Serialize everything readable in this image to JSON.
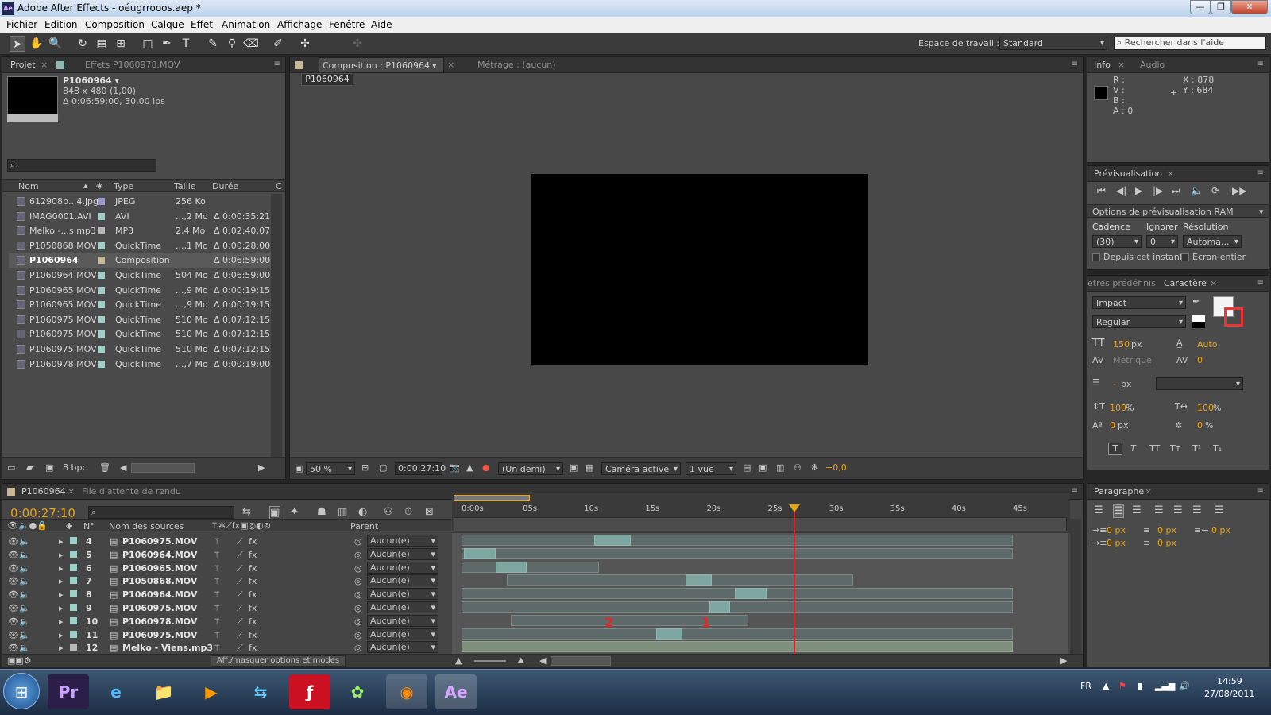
{
  "window": {
    "title": "Adobe After Effects - oéugrrooos.aep *",
    "app_icon": "Ae"
  },
  "menu": [
    "Fichier",
    "Edition",
    "Composition",
    "Calque",
    "Effet",
    "Animation",
    "Affichage",
    "Fenêtre",
    "Aide"
  ],
  "toolbar": {
    "workspace_label": "Espace de travail :",
    "workspace_value": "Standard",
    "search_placeholder": "Rechercher dans l'aide"
  },
  "project": {
    "tabs": [
      "Projet",
      "Effets P1060978.MOV"
    ],
    "item_name": "P1060964 ▾",
    "item_dims": "848 x 480 (1,00)",
    "item_duration": "Δ 0:06:59:00, 30,00 ips",
    "columns": [
      "Nom",
      "Type",
      "Taille",
      "Durée",
      "C"
    ],
    "rows": [
      {
        "name": "612908b...4.jpg",
        "type": "JPEG",
        "size": "256 Ko",
        "dur": "",
        "lc": "#9a9ad0"
      },
      {
        "name": "IMAG0001.AVI",
        "type": "AVI",
        "size": "...,2 Mo",
        "dur": "Δ 0:00:35:21",
        "lc": "#9fd0c8"
      },
      {
        "name": "Melko -...s.mp3",
        "type": "MP3",
        "size": "2,4 Mo",
        "dur": "Δ 0:02:40:07",
        "lc": "#b8b8b8"
      },
      {
        "name": "P1050868.MOV",
        "type": "QuickTime",
        "size": "...,1 Mo",
        "dur": "Δ 0:00:28:00",
        "lc": "#9fd0c8"
      },
      {
        "name": "P1060964",
        "type": "Composition",
        "size": "",
        "dur": "Δ 0:06:59:00",
        "lc": "#c8b896"
      },
      {
        "name": "P1060964.MOV",
        "type": "QuickTime",
        "size": "504 Mo",
        "dur": "Δ 0:06:59:00",
        "lc": "#9fd0c8"
      },
      {
        "name": "P1060965.MOV",
        "type": "QuickTime",
        "size": "...,9 Mo",
        "dur": "Δ 0:00:19:15",
        "lc": "#9fd0c8"
      },
      {
        "name": "P1060965.MOV",
        "type": "QuickTime",
        "size": "...,9 Mo",
        "dur": "Δ 0:00:19:15",
        "lc": "#9fd0c8"
      },
      {
        "name": "P1060975.MOV",
        "type": "QuickTime",
        "size": "510 Mo",
        "dur": "Δ 0:07:12:15",
        "lc": "#9fd0c8"
      },
      {
        "name": "P1060975.MOV",
        "type": "QuickTime",
        "size": "510 Mo",
        "dur": "Δ 0:07:12:15",
        "lc": "#9fd0c8"
      },
      {
        "name": "P1060975.MOV",
        "type": "QuickTime",
        "size": "510 Mo",
        "dur": "Δ 0:07:12:15",
        "lc": "#9fd0c8"
      },
      {
        "name": "P1060978.MOV",
        "type": "QuickTime",
        "size": "...,7 Mo",
        "dur": "Δ 0:00:19:00",
        "lc": "#9fd0c8"
      }
    ],
    "bpc": "8 bpc"
  },
  "comp": {
    "tabs": [
      "Composition : P1060964",
      "Métrage : (aucun)"
    ],
    "crumb": "P1060964",
    "zoom": "50 %",
    "time": "0:00:27:10",
    "resolution": "(Un demi)",
    "camera": "Caméra active",
    "views": "1 vue",
    "exposure": "+0,0"
  },
  "info": {
    "tabs": [
      "Info",
      "Audio"
    ],
    "r": "R :",
    "v": "V :",
    "b": "B :",
    "a": "A : 0",
    "x": "X : 878",
    "y": "Y : 684"
  },
  "preview": {
    "tab": "Prévisualisation",
    "ram": "Options de prévisualisation RAM",
    "cadence_label": "Cadence",
    "ignorer_label": "Ignorer",
    "resolution_label": "Résolution",
    "cadence": "(30)",
    "ignorer": "0",
    "resolution": "Automa...",
    "from_now": "Depuis cet instant",
    "fullscreen": "Ecran entier"
  },
  "character": {
    "tabs": [
      "etres prédéfinis",
      "Caractère"
    ],
    "font": "Impact",
    "style": "Regular",
    "size": "150",
    "size_unit": "px",
    "leading": "Auto",
    "kerning": "Métrique",
    "tracking": "0",
    "stroke": "-",
    "stroke_unit": "px",
    "vscale": "100",
    "hscale": "100",
    "pct": "%",
    "baseline": "0",
    "baseline_unit": "px",
    "tsume": "0",
    "tsume_unit": "%"
  },
  "paragraph": {
    "tab": "Paragraphe",
    "indents": [
      "0 px",
      "0 px",
      "0 px",
      "0 px",
      "0 px"
    ]
  },
  "timeline": {
    "tabs": [
      "P1060964",
      "File d'attente de rendu"
    ],
    "time": "0:00:27:10",
    "cols": {
      "num": "N°",
      "src": "Nom des sources",
      "parent": "Parent"
    },
    "ruler": [
      "0:00s",
      "05s",
      "10s",
      "15s",
      "20s",
      "25s",
      "30s",
      "35s",
      "40s",
      "45s"
    ],
    "layers": [
      {
        "n": "4",
        "name": "P1060975.MOV",
        "parent": "Aucun(e)"
      },
      {
        "n": "5",
        "name": "P1060964.MOV",
        "parent": "Aucun(e)"
      },
      {
        "n": "6",
        "name": "P1060965.MOV",
        "parent": "Aucun(e)"
      },
      {
        "n": "7",
        "name": "P1050868.MOV",
        "parent": "Aucun(e)"
      },
      {
        "n": "8",
        "name": "P1060964.MOV",
        "parent": "Aucun(e)"
      },
      {
        "n": "9",
        "name": "P1060975.MOV",
        "parent": "Aucun(e)"
      },
      {
        "n": "10",
        "name": "P1060978.MOV",
        "parent": "Aucun(e)"
      },
      {
        "n": "11",
        "name": "P1060975.MOV",
        "parent": "Aucun(e)"
      },
      {
        "n": "12",
        "name": "Melko - Viens.mp3",
        "parent": "Aucun(e)"
      }
    ],
    "annot1": "2",
    "annot2": "1",
    "toggle": "Aff./masquer options et modes"
  },
  "taskbar": {
    "lang": "FR",
    "time": "14:59",
    "date": "27/08/2011",
    "apps": [
      "Pr",
      "e",
      "📁",
      "▶",
      "⇆",
      "ƒ",
      "✿",
      "◉",
      "Ae"
    ]
  }
}
